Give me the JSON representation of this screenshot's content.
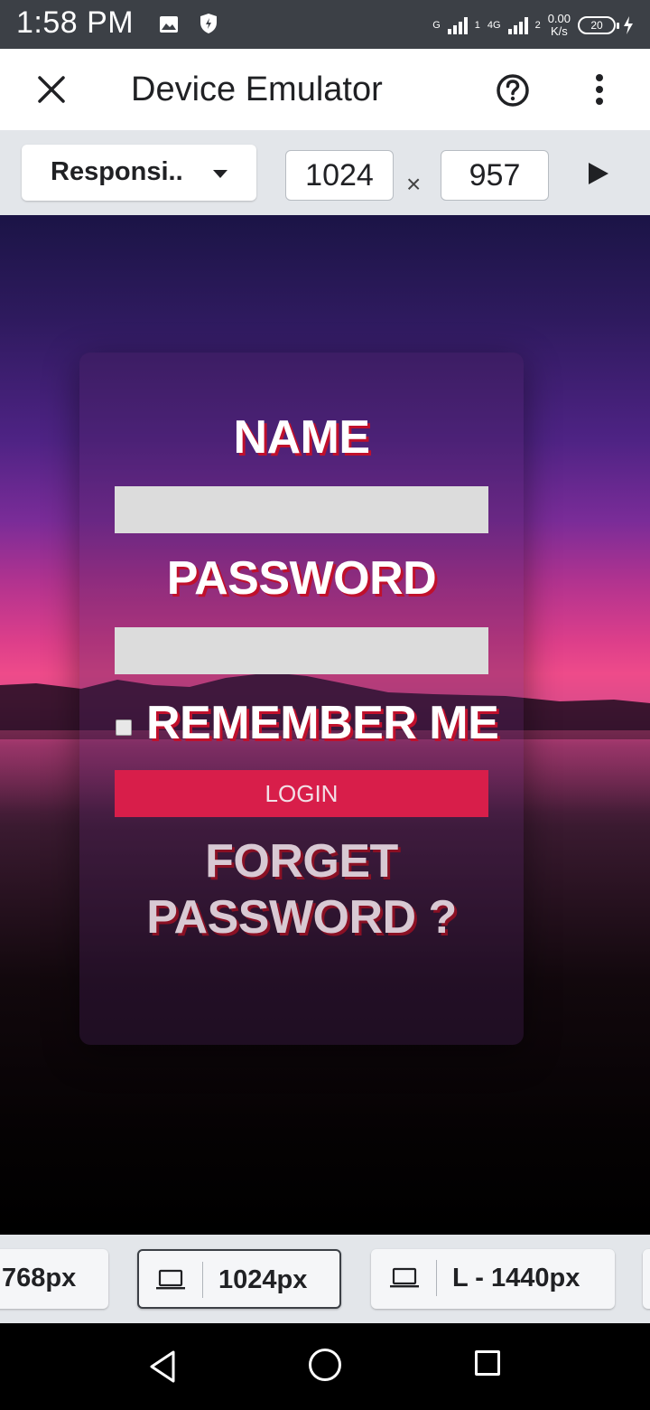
{
  "status_bar": {
    "time": "1:58 PM",
    "network_type": "G",
    "sim1_label": "1",
    "lte_label": "4G",
    "sim2_label": "2",
    "speed_value": "0.00",
    "speed_unit": "K/s",
    "battery_level": "20",
    "icons": [
      "gallery-icon",
      "shield-icon",
      "signal-icon",
      "battery-icon",
      "charging-icon"
    ]
  },
  "app_bar": {
    "title": "Device Emulator",
    "icons": [
      "close-icon",
      "help-icon",
      "more-vert-icon"
    ]
  },
  "toolbar": {
    "device_select": "Responsi..",
    "width_value": "1024",
    "times_symbol": "×",
    "height_value": "957",
    "icons": [
      "dropdown-caret-icon",
      "play-icon"
    ]
  },
  "login_form": {
    "name_label": "NAME",
    "name_value": "",
    "password_label": "PASSWORD",
    "password_value": "",
    "remember_label": "REMEMBER ME",
    "remember_checked": false,
    "login_button": "LOGIN",
    "forget_line1": "FORGET",
    "forget_line2": "PASSWORD ?",
    "colors": {
      "login_button": "#d81e4a",
      "label_shadow": "#c0102c",
      "input_bg": "#dcdcdc"
    }
  },
  "breakpoints": {
    "items": [
      {
        "label": "768px"
      },
      {
        "label": "1024px",
        "active": true
      },
      {
        "label": "L - 1440px"
      }
    ],
    "icons": [
      "laptop-icon"
    ]
  },
  "nav_bar": {
    "icons": [
      "back-icon",
      "home-icon",
      "recents-icon"
    ]
  }
}
